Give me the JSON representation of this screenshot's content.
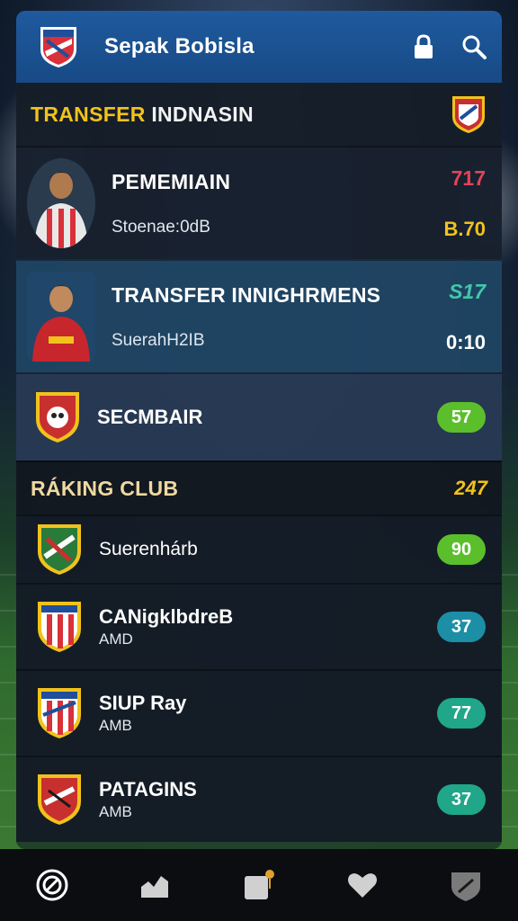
{
  "header": {
    "title": "Sepak Bobisla"
  },
  "transfer": {
    "title_highlight": "TRANSFER",
    "title_rest": " INDNASIN",
    "rows": [
      {
        "name": "PEMEMIAIN",
        "sub": "Stoenae:0dB",
        "value_top": "717",
        "value_bottom": "B.70"
      },
      {
        "name": "TRANSFER INNIGHRMENS",
        "sub": "SuerahH2IB",
        "value_top": "S17",
        "value_bottom": "0:10"
      },
      {
        "name": "SECMBAIR",
        "score": "57"
      }
    ]
  },
  "ranking": {
    "title_highlight": "RÁKING",
    "title_rest": " CLUB",
    "value": "247",
    "rows": [
      {
        "name": "Suerenhárb",
        "sub": "",
        "score": "90"
      },
      {
        "name": "CANigklbdreB",
        "sub": "AMD",
        "score": "37"
      },
      {
        "name": "SIUP Ray",
        "sub": "AMB",
        "score": "77"
      },
      {
        "name": "PATAGINS",
        "sub": "AMB",
        "score": "37"
      }
    ]
  },
  "colors": {
    "accent_gold": "#f2c21c",
    "value_red": "#e0455a",
    "value_yellow": "#f2c21c",
    "green_pill": "#5bbf2c",
    "teal_pill": "#1c8fa6",
    "teal_green_pill": "#20a688",
    "header_blue": "#1f5a9e"
  },
  "icons": {
    "top": [
      "crest-logo",
      "lock-icon",
      "search-icon"
    ],
    "bottom": [
      "home-icon",
      "stats-icon",
      "trophy-icon",
      "heart-icon",
      "club-icon"
    ]
  }
}
